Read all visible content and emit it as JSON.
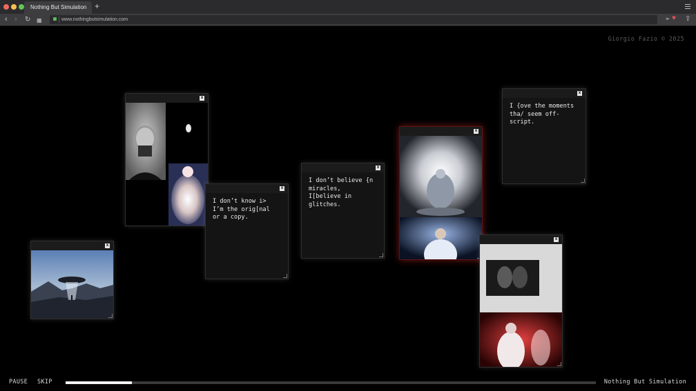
{
  "browser": {
    "tab_title": "Nothing But Simulation",
    "new_tab": "+",
    "url": "www.nothingbutsimulation.com"
  },
  "site": {
    "credit": "Giorgio Fazio © 2025",
    "footer_title": "Nothing But Simulation"
  },
  "windows": {
    "close_label": "x",
    "quote1": "I don’t know i>\nI’m the orig[nal\nor a copy.",
    "quote2": "I don’t believe {n\nmiracles,\nI[believe in\nglitches.",
    "quote3": "I {ove the moments\ntha/ seem off-\nscript."
  },
  "controls": {
    "pause_label": "PAUSE",
    "skip_label": "SKIP",
    "progress": 0.125
  }
}
